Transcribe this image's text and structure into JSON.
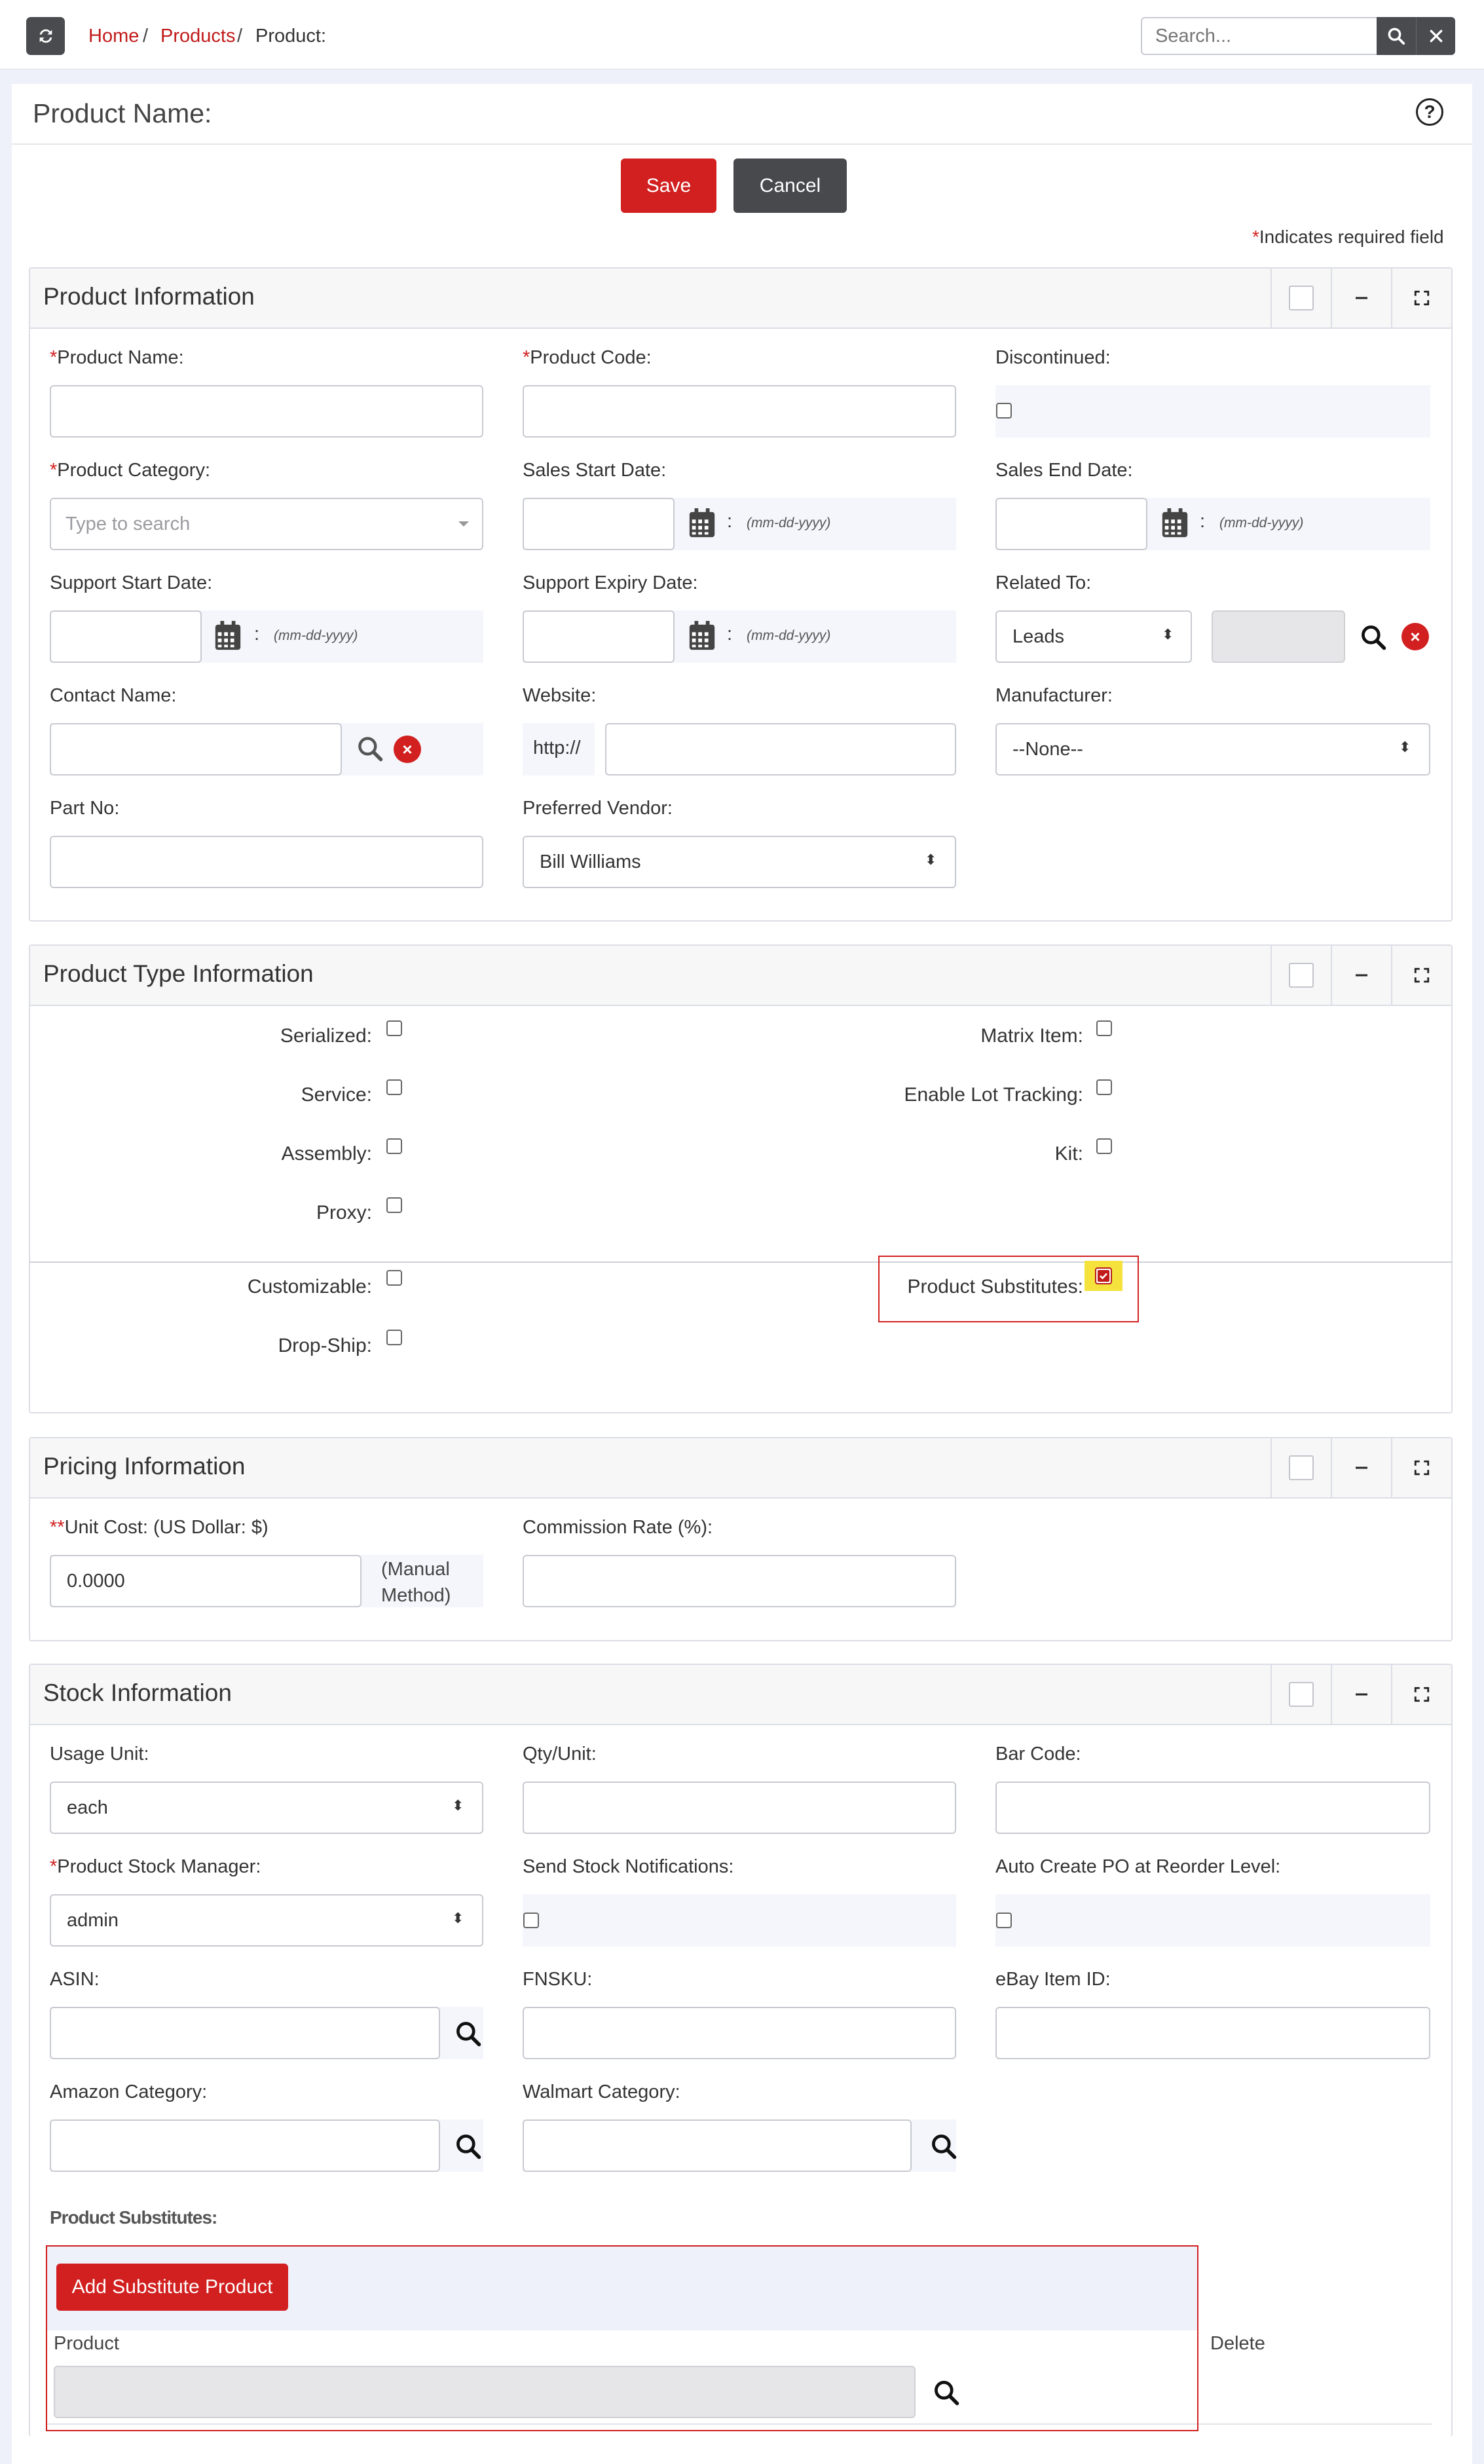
{
  "breadcrumb": {
    "home": "Home",
    "products": "Products",
    "current": "Product:",
    "sep": "/"
  },
  "search": {
    "placeholder": "Search...",
    "search_icon": "search-icon",
    "clear_icon": "close-icon"
  },
  "page": {
    "title": "Product Name:",
    "help_icon": "help-icon",
    "help_glyph": "?"
  },
  "actions": {
    "save": "Save",
    "cancel": "Cancel"
  },
  "required_note": {
    "star": "*",
    "text": "Indicates required field"
  },
  "product_info": {
    "title": "Product Information",
    "product_name": {
      "star": "*",
      "label": "Product Name:",
      "value": ""
    },
    "product_code": {
      "star": "*",
      "label": "Product Code:",
      "value": ""
    },
    "discontinued": {
      "label": "Discontinued:",
      "checked": false
    },
    "product_category": {
      "star": "*",
      "label": "Product Category:",
      "placeholder": "Type to search"
    },
    "sales_start": {
      "label": "Sales Start Date:",
      "hint": "(mm-dd-yyyy)"
    },
    "sales_end": {
      "label": "Sales End Date:",
      "hint": "(mm-dd-yyyy)"
    },
    "support_start": {
      "label": "Support Start Date:",
      "hint": "(mm-dd-yyyy)"
    },
    "support_expiry": {
      "label": "Support Expiry Date:",
      "hint": "(mm-dd-yyyy)"
    },
    "related_to": {
      "label": "Related To:",
      "value": "Leads"
    },
    "contact_name": {
      "label": "Contact Name:"
    },
    "website": {
      "label": "Website:",
      "prefix": "http://"
    },
    "manufacturer": {
      "label": "Manufacturer:",
      "value": "--None--"
    },
    "part_no": {
      "label": "Part No:"
    },
    "preferred_vendor": {
      "label": "Preferred Vendor:",
      "value": "Bill Williams"
    }
  },
  "product_type": {
    "title": "Product Type Information",
    "serialized": {
      "label": "Serialized:",
      "checked": false
    },
    "matrix_item": {
      "label": "Matrix Item:",
      "checked": false
    },
    "service": {
      "label": "Service:",
      "checked": false
    },
    "lot_tracking": {
      "label": "Enable Lot Tracking:",
      "checked": false
    },
    "assembly": {
      "label": "Assembly:",
      "checked": false
    },
    "kit": {
      "label": "Kit:",
      "checked": false
    },
    "proxy": {
      "label": "Proxy:",
      "checked": false
    },
    "customizable": {
      "label": "Customizable:",
      "checked": false
    },
    "substitutes": {
      "label": "Product Substitutes:",
      "checked": true
    },
    "drop_ship": {
      "label": "Drop-Ship:",
      "checked": false
    }
  },
  "pricing": {
    "title": "Pricing Information",
    "unit_cost": {
      "stars": "**",
      "label": "Unit Cost:",
      "currency": "(US Dollar: $)",
      "value": "0.0000",
      "method_line1": "(Manual",
      "method_line2": "Method)"
    },
    "commission": {
      "label": "Commission Rate (%):"
    }
  },
  "stock": {
    "title": "Stock Information",
    "usage_unit": {
      "label": "Usage Unit:",
      "value": "each"
    },
    "qty_unit": {
      "label": "Qty/Unit:"
    },
    "bar_code": {
      "label": "Bar Code:"
    },
    "stock_manager": {
      "star": "*",
      "label": "Product Stock Manager:",
      "value": "admin"
    },
    "send_notifications": {
      "label": "Send Stock Notifications:",
      "checked": false
    },
    "auto_po": {
      "label": "Auto Create PO at Reorder Level:",
      "checked": false
    },
    "asin": {
      "label": "ASIN:"
    },
    "fnsku": {
      "label": "FNSKU:"
    },
    "ebay": {
      "label": "eBay Item ID:"
    },
    "amazon_category": {
      "label": "Amazon Category:"
    },
    "walmart_category": {
      "label": "Walmart Category:"
    }
  },
  "substitutes": {
    "title": "Product Substitutes:",
    "add_button": "Add Substitute Product",
    "col_product": "Product",
    "col_delete": "Delete"
  },
  "colors": {
    "accent": "#d21f1f",
    "dark_button": "#48494d",
    "highlight": "#f5e23c"
  }
}
